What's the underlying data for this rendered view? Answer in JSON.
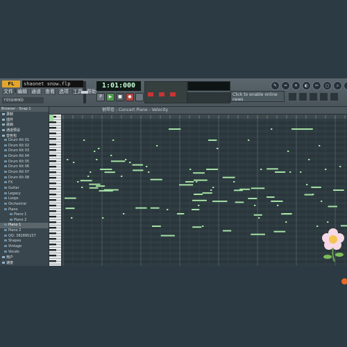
{
  "window": {
    "title": "shaonet snow.flp",
    "logo": "FL STUDIO",
    "hint": "Y956HHKD"
  },
  "menu": [
    "文件",
    "编辑",
    "通道",
    "查看",
    "选项",
    "工具",
    "帮助"
  ],
  "transport": {
    "time": "1:01:000"
  },
  "news": "Click to enable online news",
  "browser": {
    "header": "Browser - Snap 1",
    "items": [
      {
        "label": "录制",
        "level": "top"
      },
      {
        "label": "插件",
        "level": "top"
      },
      {
        "label": "歌曲",
        "level": "top"
      },
      {
        "label": "通道预设",
        "level": "top"
      },
      {
        "label": "音色包",
        "level": "top"
      },
      {
        "label": "Drum Kit 01",
        "level": "sub"
      },
      {
        "label": "Drum Kit 02",
        "level": "sub"
      },
      {
        "label": "Drum Kit 03",
        "level": "sub"
      },
      {
        "label": "Drum Kit 04",
        "level": "sub"
      },
      {
        "label": "Drum Kit 05",
        "level": "sub"
      },
      {
        "label": "Drum Kit 06",
        "level": "sub"
      },
      {
        "label": "Drum Kit 07",
        "level": "sub"
      },
      {
        "label": "Drum Kit 08",
        "level": "sub"
      },
      {
        "label": "FX",
        "level": "sub"
      },
      {
        "label": "Guitar",
        "level": "sub"
      },
      {
        "label": "Legacy",
        "level": "sub"
      },
      {
        "label": "Loops",
        "level": "sub"
      },
      {
        "label": "Orchestral",
        "level": "sub"
      },
      {
        "label": "Piano",
        "level": "sub"
      },
      {
        "label": "Piano 1",
        "level": "sub2"
      },
      {
        "label": "Piano 2",
        "level": "sub2"
      },
      {
        "label": "Piano 1",
        "level": "sel"
      },
      {
        "label": "Piano 2",
        "level": "sub"
      },
      {
        "label": "QQ: 382895237",
        "level": "sub"
      },
      {
        "label": "Shapes",
        "level": "sub"
      },
      {
        "label": "Vintage",
        "level": "sub"
      },
      {
        "label": "Vocals",
        "level": "sub"
      },
      {
        "label": "用户",
        "level": "top"
      },
      {
        "label": "速度",
        "level": "top"
      }
    ]
  },
  "piano_roll": {
    "title": "钢琴卷 - Concert Piano - Velocity"
  },
  "icons": [
    "pencil-icon",
    "brush-icon",
    "delete-icon",
    "mute-icon",
    "slice-icon",
    "select-icon",
    "zoom-icon",
    "play-icon"
  ],
  "colors": {
    "note": "#a6e3a6",
    "grid_bg": "#2f3d43",
    "accent": "#e5a52a"
  }
}
